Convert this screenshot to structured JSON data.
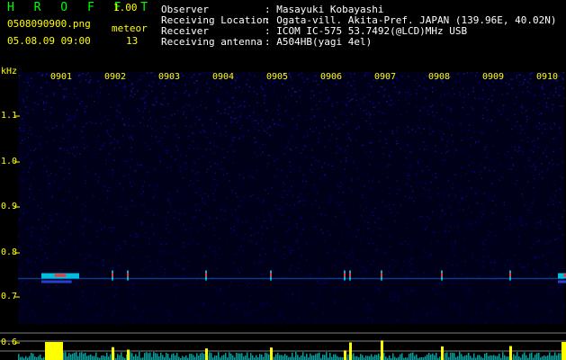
{
  "header": {
    "app_name": "H R O F F T",
    "app_version": "1.00",
    "filename": "0508090900.png",
    "datetime": "05.08.09 09:00",
    "meteor_label": "meteor",
    "meteor_count": "13"
  },
  "station_info": {
    "rows": [
      {
        "label": "Observer",
        "value": ": Masayuki Kobayashi"
      },
      {
        "label": "Receiving Location",
        "value": ": Ogata-vill. Akita-Pref. JAPAN (139.96E, 40.02N)"
      },
      {
        "label": "Receiver",
        "value": ": ICOM IC-575 53.7492(@LCD)MHz USB"
      },
      {
        "label": "Receiving antenna",
        "value": ": A504HB(yagi 4el)"
      }
    ]
  },
  "chart_data": {
    "type": "heatmap",
    "title": "",
    "xlabel": "",
    "ylabel": "kHz",
    "x_ticks": [
      "0901",
      "0902",
      "0903",
      "0904",
      "0905",
      "0906",
      "0907",
      "0908",
      "0909",
      "0910"
    ],
    "y_ticks": [
      "1.1",
      "1.0",
      "0.9",
      "0.8",
      "0.7",
      "0.6"
    ],
    "y_range": [
      0.6,
      1.2
    ],
    "meteor_echo_times": [
      "0901",
      "0902",
      "0902",
      "0904",
      "0905",
      "0906",
      "0906",
      "0907",
      "0908",
      "0909",
      "0910"
    ],
    "echo_band_khz": 0.75
  },
  "colors": {
    "background": "#000000",
    "title_green": "#00ff00",
    "version_yellow": "#ffff00",
    "text_white": "#ffffff",
    "spectrum_noise": "#0000a0",
    "echo_cyan": "#00e0ff",
    "echo_red": "#ff3030",
    "signal_yellow": "#ffff00",
    "noise_cyan": "#00c8c8"
  }
}
